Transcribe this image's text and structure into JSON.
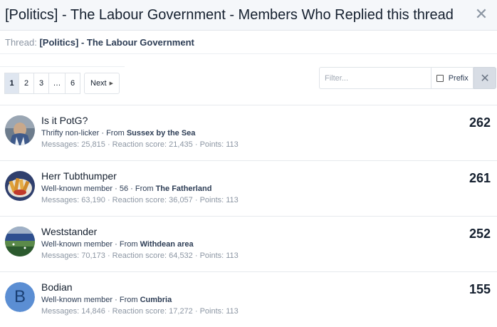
{
  "header": {
    "title": "[Politics] - The Labour Government - Members Who Replied this thread",
    "close_icon": "close-icon"
  },
  "thread": {
    "prefix": "Thread:",
    "link": "[Politics] - The Labour Government"
  },
  "pagination": {
    "pages": [
      "1",
      "2",
      "3",
      "…",
      "6"
    ],
    "current": "1",
    "next_label": "Next"
  },
  "filter": {
    "placeholder": "Filter...",
    "prefix_label": "Prefix",
    "clear_icon": "close-icon"
  },
  "members": [
    {
      "name": "Is it PotG?",
      "title": "Thrifty non-licker",
      "from_label": "From",
      "location": "Sussex by the Sea",
      "stats": "Messages: 25,815 · Reaction score: 21,435 · Points: 113",
      "count": "262",
      "avatar": "photo"
    },
    {
      "name": "Herr Tubthumper",
      "title": "Well-known member · 56",
      "from_label": "From",
      "location": "The Fatherland",
      "stats": "Messages: 63,190 · Reaction score: 36,057 · Points: 113",
      "count": "261",
      "avatar": "photo"
    },
    {
      "name": "Weststander",
      "title": "Well-known member",
      "from_label": "From",
      "location": "Withdean area",
      "stats": "Messages: 70,173 · Reaction score: 64,532 · Points: 113",
      "count": "252",
      "avatar": "photo"
    },
    {
      "name": "Bodian",
      "title": "Well-known member",
      "from_label": "From",
      "location": "Cumbria",
      "stats": "Messages: 14,846 · Reaction score: 17,272 · Points: 113",
      "count": "155",
      "avatar": "letter",
      "avatar_letter": "B"
    }
  ],
  "colors": {
    "header_bg": "#f5f7fa",
    "current_page_bg": "#dfe6f0",
    "letter_avatar_bg": "#5b8ed3"
  }
}
